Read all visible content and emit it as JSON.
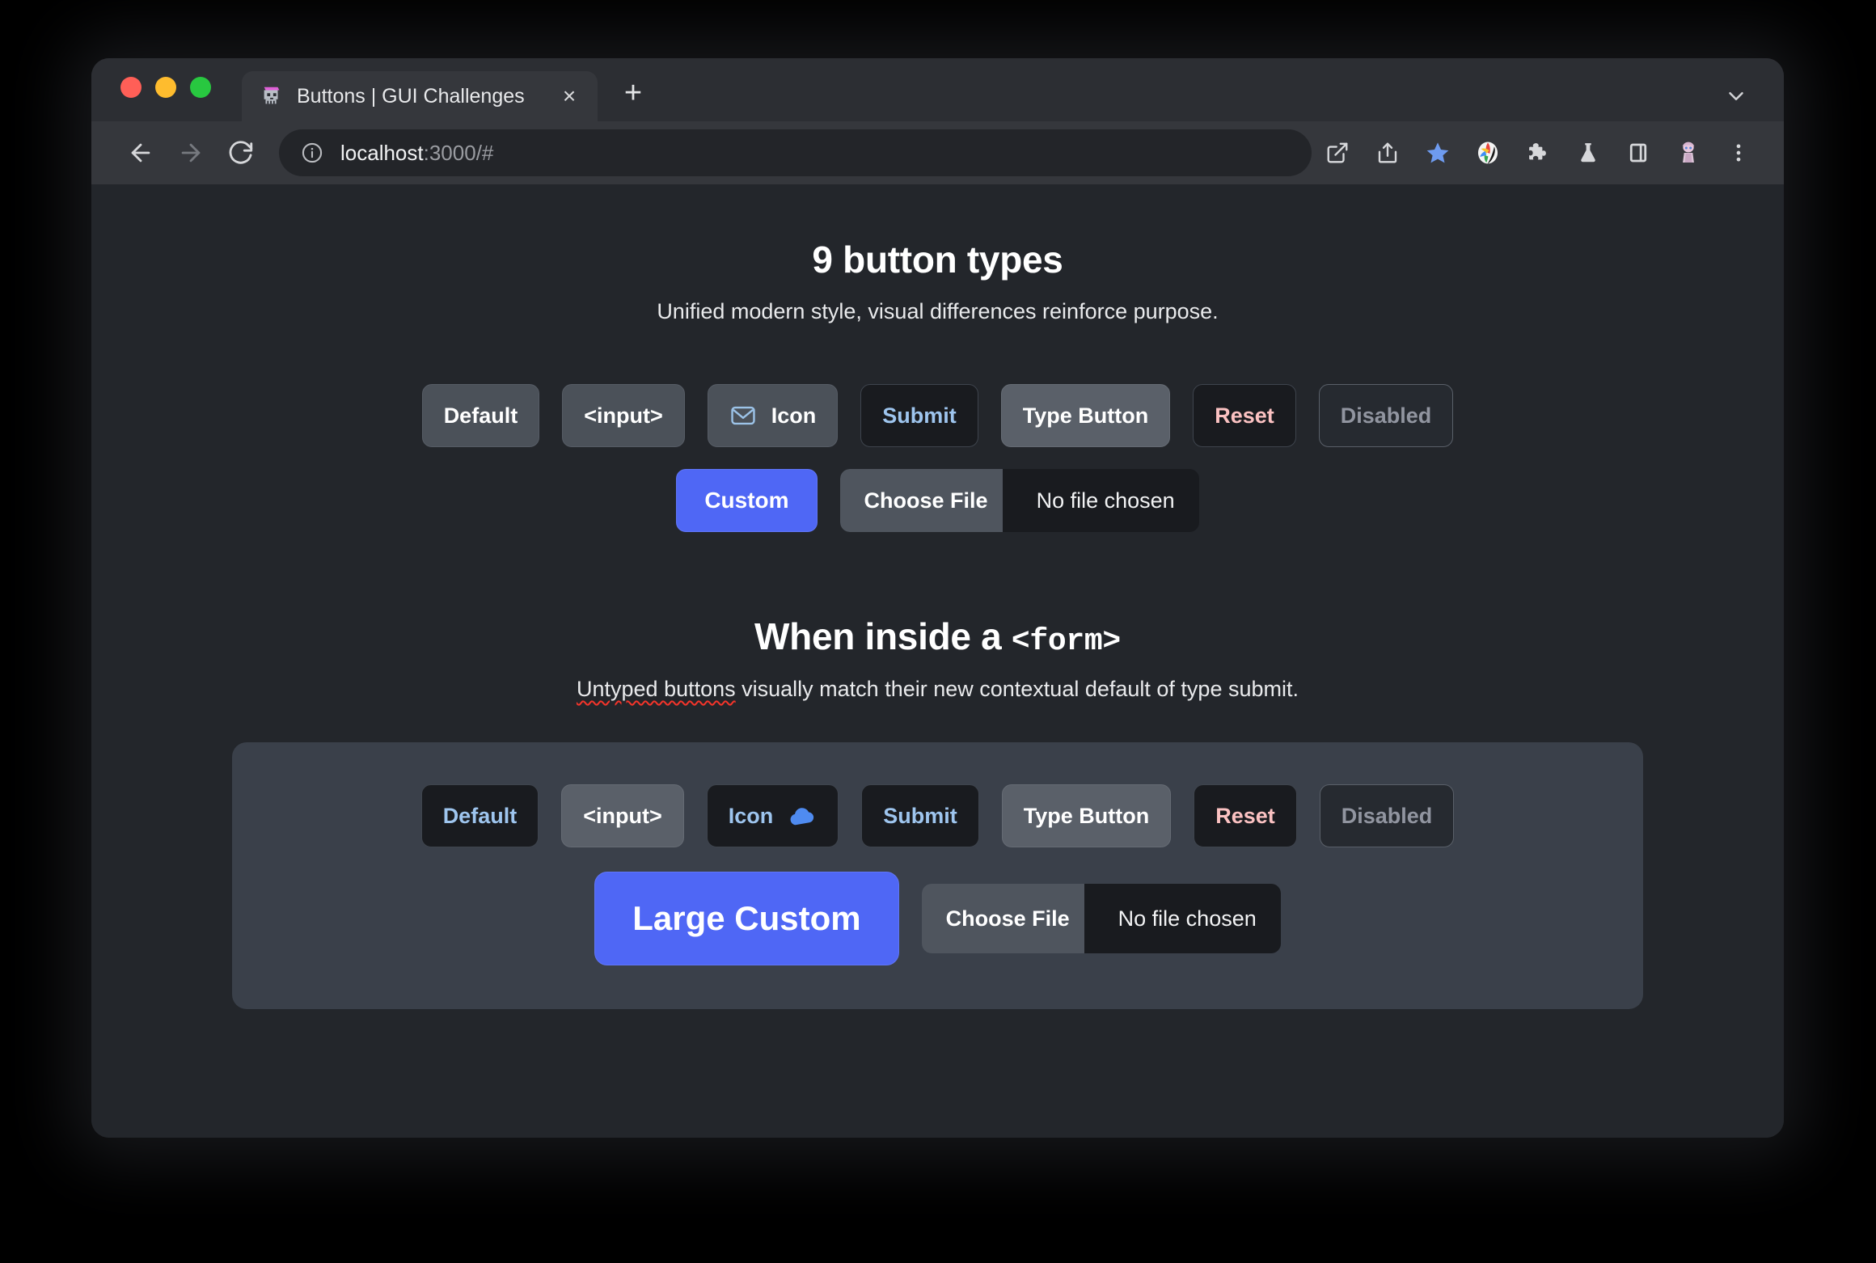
{
  "browser": {
    "traffic_lights": {
      "close_color": "#FF5F57",
      "minimize_color": "#FEBC2E",
      "maximize_color": "#28C840"
    },
    "tab": {
      "title": "Buttons | GUI Challenges",
      "favicon_name": "skull-with-pink-cap-favicon",
      "close_label": "×"
    },
    "new_tab_label": "+",
    "toolbar": {
      "back_label": "←",
      "forward_label": "→",
      "reload_label": "↻",
      "url_host": "localhost",
      "url_rest": ":3000/#",
      "url_full": "localhost:3000/#",
      "icons": [
        "open-in-new-icon",
        "share-icon",
        "bookmark-star-icon",
        "color-palette-extension-icon",
        "puzzle-extensions-icon",
        "flask-labs-icon",
        "side-panel-icon",
        "profile-avatar-icon",
        "three-dot-menu-icon"
      ],
      "star_color": "#6E9BF0"
    }
  },
  "page": {
    "section_one": {
      "heading": "9 button types",
      "subtitle": "Unified modern style, visual differences reinforce purpose.",
      "buttons": [
        {
          "label": "Default",
          "style": "default",
          "icon": null
        },
        {
          "label": "<input>",
          "style": "default",
          "icon": null
        },
        {
          "label": "Icon",
          "style": "icon-plain",
          "icon": "envelope-icon",
          "icon_position": "left",
          "icon_color": "#9CC3E8"
        },
        {
          "label": "Submit",
          "style": "submitish",
          "icon": null
        },
        {
          "label": "Type Button",
          "style": "typebutton",
          "icon": null
        },
        {
          "label": "Reset",
          "style": "reset",
          "icon": null
        },
        {
          "label": "Disabled",
          "style": "disabled",
          "icon": null
        }
      ],
      "custom_label": "Custom",
      "file": {
        "button_label": "Choose File",
        "status_label": "No file chosen"
      }
    },
    "section_two": {
      "heading_text": "When inside a ",
      "heading_mono": "<form>",
      "subtitle_spell": "Untyped buttons",
      "subtitle_rest": " visually match their new contextual default of type submit.",
      "buttons": [
        {
          "label": "Default",
          "style": "submitish",
          "icon": null
        },
        {
          "label": "<input>",
          "style": "typebutton",
          "icon": null
        },
        {
          "label": "Icon",
          "style": "submitish",
          "icon": "cloud-icon",
          "icon_position": "right",
          "icon_color": "#4F8BF0"
        },
        {
          "label": "Submit",
          "style": "submitish",
          "icon": null
        },
        {
          "label": "Type Button",
          "style": "typebutton",
          "icon": null
        },
        {
          "label": "Reset",
          "style": "reset",
          "icon": null
        },
        {
          "label": "Disabled",
          "style": "disabled",
          "icon": null
        }
      ],
      "custom_label": "Large Custom",
      "file": {
        "button_label": "Choose File",
        "status_label": "No file chosen"
      }
    }
  },
  "colors": {
    "page_bg": "#23262B",
    "form_box_bg": "#3A404A",
    "accent_blue": "#4F67F5",
    "submit_text": "#9EC5EE",
    "reset_text": "#FBC2C2",
    "disabled_text": "#9195A0",
    "spellcheck_underline": "#F5342A"
  }
}
